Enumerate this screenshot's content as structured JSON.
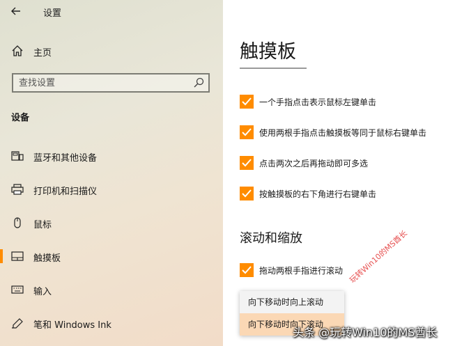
{
  "app": {
    "title": "设置"
  },
  "sidebar": {
    "home_label": "主页",
    "search_placeholder": "查找设置",
    "group_title": "设备",
    "items": [
      {
        "label": "蓝牙和其他设备",
        "icon": "bluetooth-devices-icon",
        "selected": false
      },
      {
        "label": "打印机和扫描仪",
        "icon": "printer-icon",
        "selected": false
      },
      {
        "label": "鼠标",
        "icon": "mouse-icon",
        "selected": false
      },
      {
        "label": "触摸板",
        "icon": "touchpad-icon",
        "selected": true
      },
      {
        "label": "输入",
        "icon": "keyboard-icon",
        "selected": false
      },
      {
        "label": "笔和 Windows Ink",
        "icon": "pen-icon",
        "selected": false
      }
    ]
  },
  "main": {
    "page_title": "触摸板",
    "checkboxes": [
      {
        "label": "一个手指点击表示鼠标左键单击",
        "checked": true
      },
      {
        "label": "使用两根手指点击触摸板等同于鼠标右键单击",
        "checked": true
      },
      {
        "label": "点击两次之后再拖动即可多选",
        "checked": true
      },
      {
        "label": "按触摸板的右下角进行右键单击",
        "checked": true
      }
    ],
    "scroll_section": {
      "title": "滚动和缩放",
      "checkbox": {
        "label": "拖动两根手指进行滚动",
        "checked": true
      },
      "dropdown_options": [
        {
          "label": "向下移动时向上滚动",
          "selected": false
        },
        {
          "label": "向下移动时向下滚动",
          "selected": true
        }
      ]
    }
  },
  "watermark": {
    "diagonal": "玩转Win10的MS酋长",
    "footer": "头条 @玩转Win10的MS酋长"
  },
  "colors": {
    "accent": "#ff8c00",
    "selected_option_bg": "#fbd8b5"
  }
}
